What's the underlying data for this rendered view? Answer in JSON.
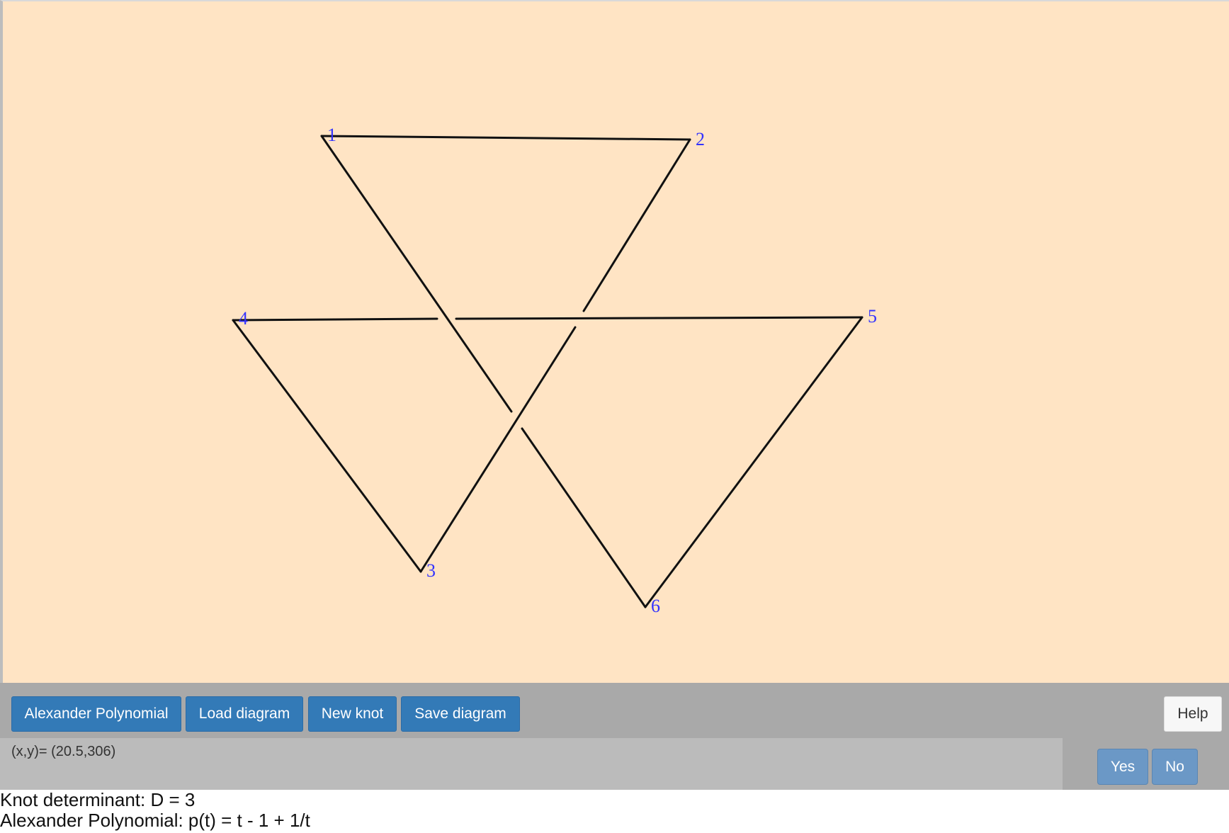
{
  "colors": {
    "canvas_bg": "#ffe4c4",
    "stroke": "#111111",
    "vertex_label": "#3333ff",
    "primary_button": "#337ab7"
  },
  "diagram": {
    "vertices": [
      {
        "label": "1"
      },
      {
        "label": "2"
      },
      {
        "label": "3"
      },
      {
        "label": "4"
      },
      {
        "label": "5"
      },
      {
        "label": "6"
      }
    ]
  },
  "toolbar": {
    "alexander_label": "Alexander Polynomial",
    "load_label": "Load diagram",
    "new_label": "New knot",
    "save_label": "Save diagram",
    "help_label": "Help"
  },
  "status": {
    "coordinates": "(x,y)= (20.5,306)"
  },
  "confirm": {
    "yes_label": "Yes",
    "no_label": "No"
  },
  "results": {
    "determinant": "Knot determinant: D = 3",
    "polynomial": "Alexander Polynomial: p(t) = t - 1 + 1/t"
  }
}
